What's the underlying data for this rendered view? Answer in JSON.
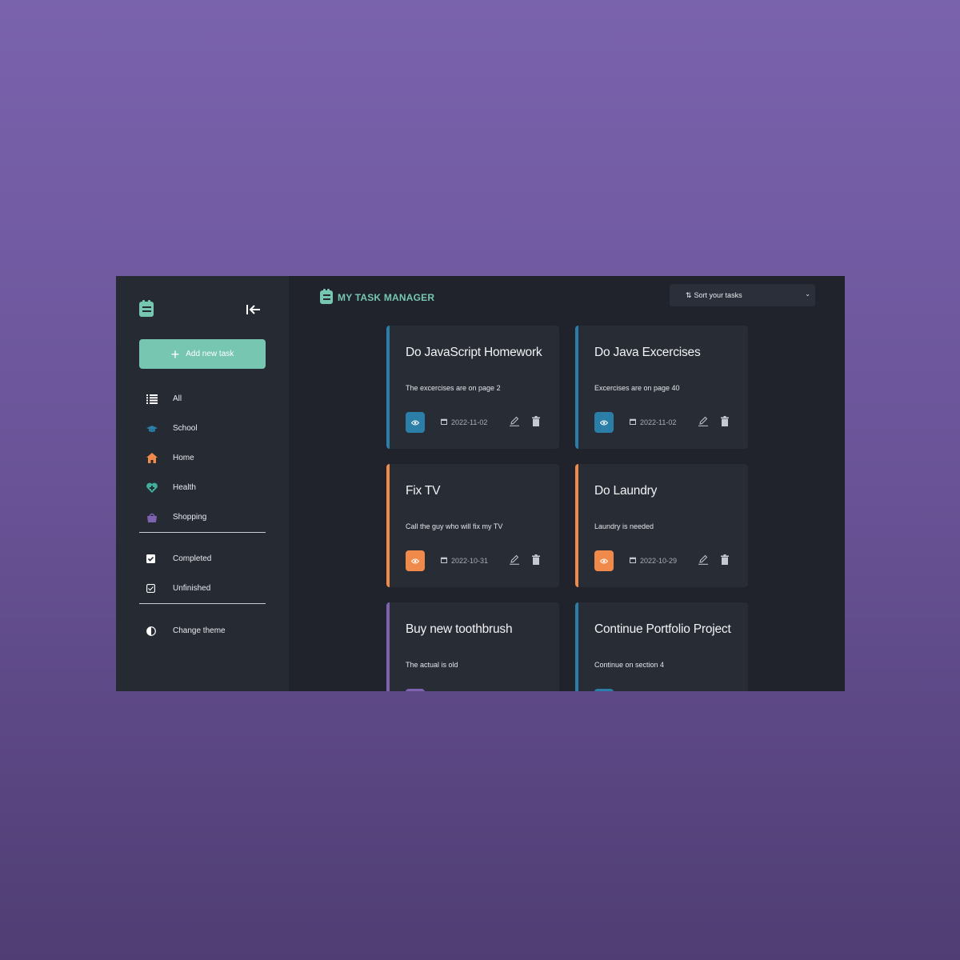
{
  "app": {
    "brand_title": "MY TASK MANAGER",
    "accent_color": "#76c6b2"
  },
  "sidebar": {
    "add_button_label": "Add new task",
    "categories": [
      {
        "label": "All",
        "icon": "list-icon"
      },
      {
        "label": "School",
        "icon": "graduation-cap-icon",
        "color": "#2a7ea8"
      },
      {
        "label": "Home",
        "icon": "house-icon",
        "color": "#f08a4b"
      },
      {
        "label": "Health",
        "icon": "heart-plus-icon",
        "color": "#3fae9a"
      },
      {
        "label": "Shopping",
        "icon": "basket-icon",
        "color": "#7d62b0"
      }
    ],
    "filters": [
      {
        "label": "Completed",
        "icon": "checkbox-checked-icon"
      },
      {
        "label": "Unfinished",
        "icon": "checkbox-outline-icon"
      }
    ],
    "theme_label": "Change theme"
  },
  "header": {
    "sort_label": "Sort your tasks"
  },
  "tasks": [
    {
      "title": "Do JavaScript Homework",
      "description": "The excercises are on page 2",
      "date": "2022-11-02",
      "category_color": "#2a7ea8"
    },
    {
      "title": "Do Java Excercises",
      "description": "Excercises are on page 40",
      "date": "2022-11-02",
      "category_color": "#2a7ea8"
    },
    {
      "title": "Fix TV",
      "description": "Call the guy who will fix my TV",
      "date": "2022-10-31",
      "category_color": "#f08a4b"
    },
    {
      "title": "Do Laundry",
      "description": "Laundry is needed",
      "date": "2022-10-29",
      "category_color": "#f08a4b"
    },
    {
      "title": "Buy new toothbrush",
      "description": "The actual is old",
      "date": "",
      "category_color": "#7d62b0"
    },
    {
      "title": "Continue Portfolio Project",
      "description": "Continue on section 4",
      "date": "",
      "category_color": "#2a7ea8"
    }
  ]
}
